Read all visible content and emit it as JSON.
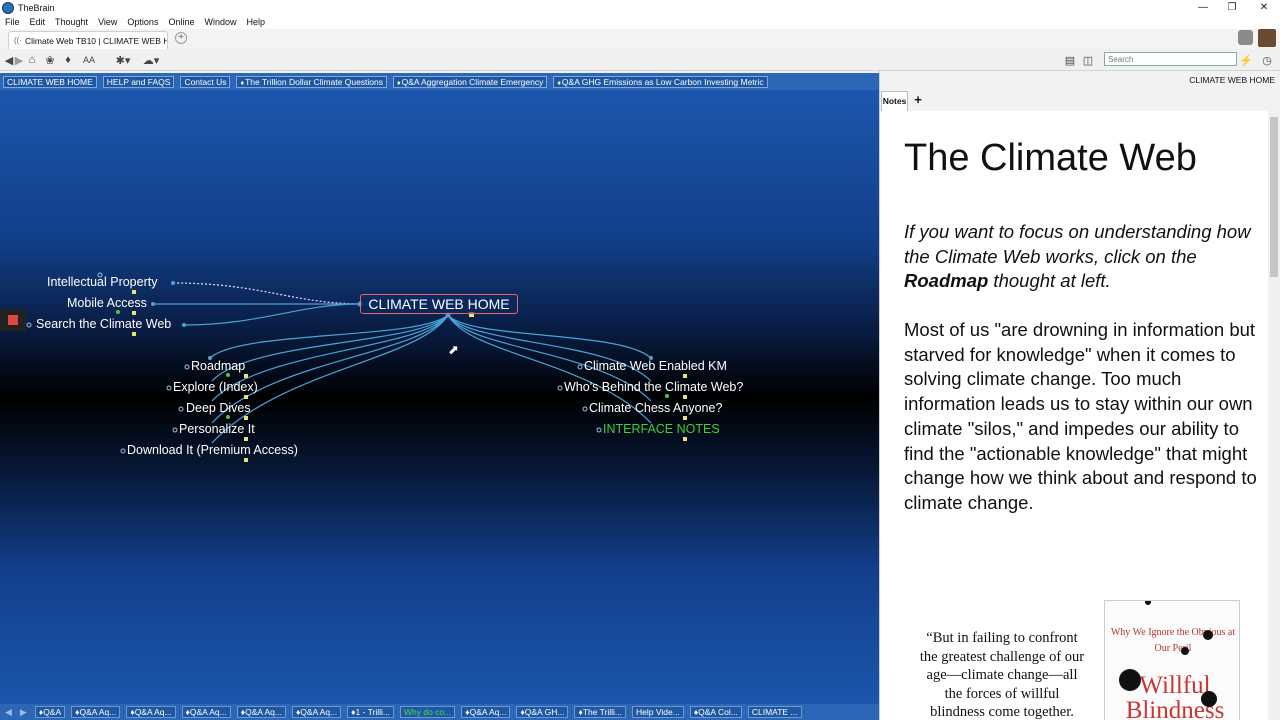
{
  "window": {
    "app_name": "TheBrain"
  },
  "menu": [
    "File",
    "Edit",
    "Thought",
    "View",
    "Options",
    "Online",
    "Window",
    "Help"
  ],
  "tab": {
    "label": "Climate Web TB10 | CLIMATE WEB H..."
  },
  "toolbar": {
    "font_label": "AA",
    "search_placeholder": "Search"
  },
  "pins": [
    {
      "label": "CLIMATE WEB HOME",
      "tag": false
    },
    {
      "label": "HELP and FAQS",
      "tag": false
    },
    {
      "label": "Contact Us",
      "tag": false
    },
    {
      "label": "The Trillion Dollar Climate Questions",
      "tag": true
    },
    {
      "label": "Q&A Aggregation Climate Emergency",
      "tag": true
    },
    {
      "label": "Q&A GHG Emissions as Low Carbon Investing Metric",
      "tag": true
    }
  ],
  "plex": {
    "central": "CLIMATE WEB HOME",
    "parents": [
      "Intellectual Property",
      "Mobile Access",
      "Search the Climate Web"
    ],
    "children_left": [
      "Roadmap",
      "Explore (Index)",
      "Deep Dives",
      "Personalize It",
      "Download It (Premium Access)"
    ],
    "children_right": [
      "Climate Web Enabled KM",
      "Who's Behind the Climate Web?",
      "Climate Chess Anyone?",
      "INTERFACE NOTES"
    ],
    "colors": {
      "link": "#4aa3d8",
      "node_text": "#ffffff",
      "interface_notes": "#3fcf3f",
      "central_border": "#e46a5a"
    }
  },
  "bottom": [
    {
      "label": "Q&A",
      "tag": true
    },
    {
      "label": "Q&A Aq...",
      "tag": true
    },
    {
      "label": "Q&A Aq...",
      "tag": true
    },
    {
      "label": "Q&A Aq...",
      "tag": true
    },
    {
      "label": "Q&A Aq...",
      "tag": true
    },
    {
      "label": "Q&A Aq...",
      "tag": true
    },
    {
      "label": "1 - Trilli...",
      "tag": true
    },
    {
      "label": "Why do co...",
      "tag": false,
      "green": true
    },
    {
      "label": "Q&A Aq...",
      "tag": true
    },
    {
      "label": "Q&A GH...",
      "tag": true
    },
    {
      "label": "The Trilli...",
      "tag": true
    },
    {
      "label": "Help Vide...",
      "tag": false
    },
    {
      "label": "Q&A Col...",
      "tag": true
    },
    {
      "label": "CLIMATE ...",
      "tag": false
    }
  ],
  "notes": {
    "caption": "CLIMATE WEB HOME",
    "tab_label": "Notes",
    "add_label": "+",
    "title": "The Climate Web",
    "intro_pre": "If you want to focus on understanding how the Climate Web works, click on the ",
    "intro_bold": "Roadmap",
    "intro_post": " thought at left.",
    "para": "Most of us \"are drowning in information but starved for knowledge\" when it comes to solving climate change. Too much information leads us to stay within our own climate \"silos,\" and impedes our ability to find the \"actionable knowledge\" that might change how we think about and respond to climate change.",
    "quote": "“But in failing to confront the greatest challenge of our age—climate change—all the forces of willful blindness come together.",
    "book_subtitle": "Why We Ignore the Obvious at Our Peril",
    "book_title": "Willful Blindness"
  }
}
